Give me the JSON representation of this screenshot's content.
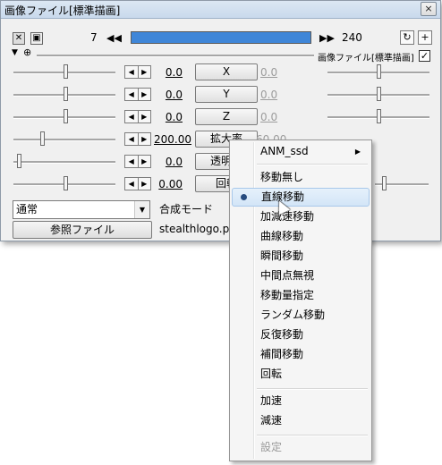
{
  "window": {
    "title": "画像ファイル[標準描画]",
    "close_label": "×"
  },
  "toolbar": {
    "start_frame": "7",
    "end_frame": "240",
    "prev_label": "◀◀",
    "next_label": "▶▶",
    "layer_label": "画像ファイル[標準描画]",
    "plus_label": "+",
    "checked": "✓"
  },
  "tracks": [
    {
      "left_value": "0.0",
      "button": "X",
      "right_value": "0.0"
    },
    {
      "left_value": "0.0",
      "button": "Y",
      "right_value": "0.0"
    },
    {
      "left_value": "0.0",
      "button": "Z",
      "right_value": "0.0"
    },
    {
      "left_value": "200.00",
      "button": "拡大率",
      "right_value": "60.00"
    },
    {
      "left_value": "0.0",
      "button": "透明度",
      "right_value": ""
    },
    {
      "left_value": "0.00",
      "button": "回転",
      "right_value": ""
    }
  ],
  "blend": {
    "value": "通常",
    "label": "合成モード"
  },
  "reference": {
    "button_label": "参照ファイル",
    "filename": "stealthlogo.png"
  },
  "context_menu": {
    "items": [
      {
        "label": "ANM_ssd",
        "submenu": true
      },
      {
        "label": "移動無し"
      },
      {
        "label": "直線移動",
        "checked": true,
        "highlighted": true
      },
      {
        "label": "加減速移動"
      },
      {
        "label": "曲線移動"
      },
      {
        "label": "瞬間移動"
      },
      {
        "label": "中間点無視"
      },
      {
        "label": "移動量指定"
      },
      {
        "label": "ランダム移動"
      },
      {
        "label": "反復移動"
      },
      {
        "label": "補間移動"
      },
      {
        "label": "回転"
      },
      {
        "label": "加速"
      },
      {
        "label": "減速"
      },
      {
        "label": "設定",
        "disabled": true
      }
    ]
  }
}
